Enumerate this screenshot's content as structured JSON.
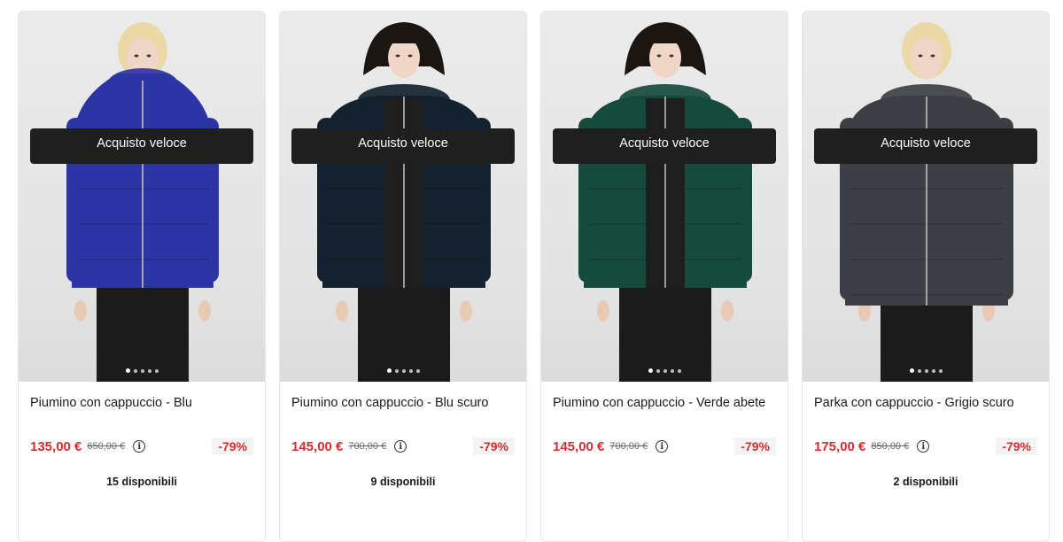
{
  "products": [
    {
      "title": "Piumino con cappuccio - Blu",
      "price": "135,00 €",
      "old_price": "650,00 €",
      "discount": "-79%",
      "stock": "15 disponibili",
      "button": "Acquisto veloce",
      "image_slides": 5,
      "active_slide": 1,
      "coat_color": "#2c35a6",
      "hair_color": "#ead9a6"
    },
    {
      "title": "Piumino con cappuccio - Blu scuro",
      "price": "145,00 €",
      "old_price": "700,00 €",
      "discount": "-79%",
      "stock": "9 disponibili",
      "button": "Acquisto veloce",
      "image_slides": 5,
      "active_slide": 1,
      "coat_color": "#14212e",
      "hair_color": "#1c1612"
    },
    {
      "title": "Piumino con cappuccio - Verde abete",
      "price": "145,00 €",
      "old_price": "700,00 €",
      "discount": "-79%",
      "stock": "",
      "button": "Acquisto veloce",
      "image_slides": 5,
      "active_slide": 1,
      "coat_color": "#154a3c",
      "hair_color": "#1c1612"
    },
    {
      "title": "Parka con cappuccio - Grigio scuro",
      "price": "175,00 €",
      "old_price": "850,00 €",
      "discount": "-79%",
      "stock": "2 disponibili",
      "button": "Acquisto veloce",
      "image_slides": 5,
      "active_slide": 1,
      "coat_color": "#3c3f44",
      "hair_color": "#ead9a6"
    }
  ],
  "info_icon": "info-circle-icon",
  "colors": {
    "price_red": "#d32f2f",
    "button_bg": "#1f1f1f",
    "discount_bg": "#f4f4f4"
  }
}
